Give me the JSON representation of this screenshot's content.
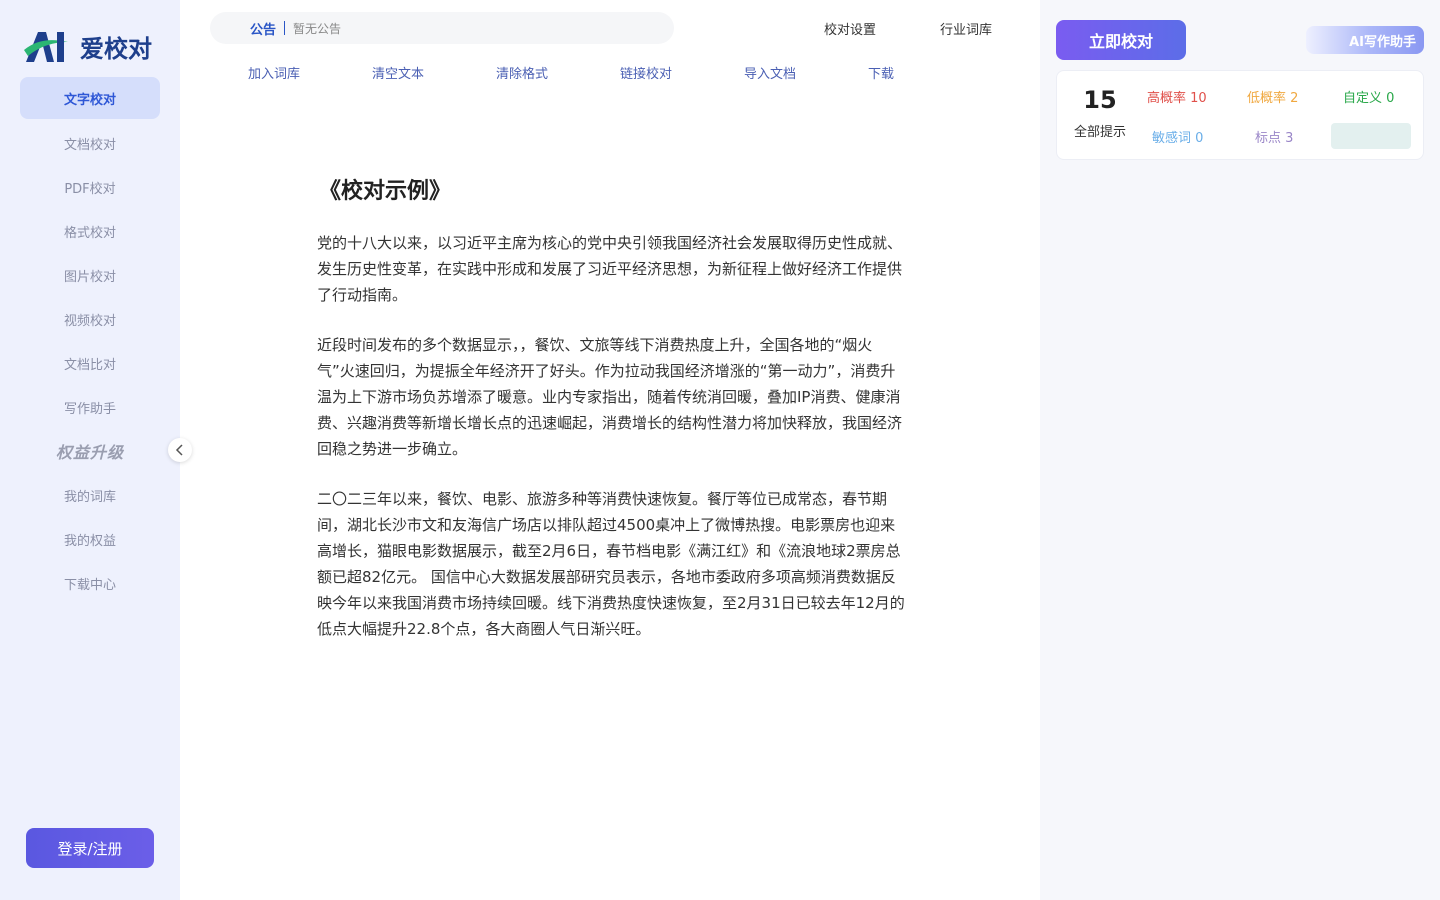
{
  "sidebar": {
    "logo_text": "爱校对",
    "items": [
      {
        "label": "文字校对"
      },
      {
        "label": "文档校对"
      },
      {
        "label": "PDF校对"
      },
      {
        "label": "格式校对"
      },
      {
        "label": "图片校对"
      },
      {
        "label": "视频校对"
      },
      {
        "label": "文档比对"
      },
      {
        "label": "写作助手"
      },
      {
        "label": "权益升级"
      },
      {
        "label": "我的词库"
      },
      {
        "label": "我的权益"
      },
      {
        "label": "下载中心"
      }
    ],
    "login_label": "登录/注册"
  },
  "notice": {
    "label": "公告",
    "text": "暂无公告"
  },
  "top_links": {
    "settings": "校对设置",
    "industry_lexicon": "行业词库"
  },
  "toolbar": {
    "add_lexicon": "加入词库",
    "clear_text": "清空文本",
    "clear_format": "清除格式",
    "link_check": "链接校对",
    "import_doc": "导入文档",
    "download": "下载"
  },
  "document": {
    "title": "《校对示例》",
    "paragraphs": [
      "党的十八大以来，以习近平主席为核心的党中央引领我国经济社会发展取得历史性成就、发生历史性变革，在实践中形成和发展了习近平经济思想，为新征程上做好经济工作提供了行动指南。",
      "近段时间发布的多个数据显示，，餐饮、文旅等线下消费热度上升，全国各地的“烟火气”火速回归，为提振全年经济开了好头。作为拉动我国经济增涨的“第一动力”，消费升温为上下游市场负苏增添了暖意。业内专家指出，随着传统消回暖，叠加IP消费、健康消费、兴趣消费等新增长增长点的迅速崛起，消费增长的结构性潜力将加快释放，我国经济回稳之势进一步确立。",
      "二〇二三年以来，餐饮、电影、旅游多种等消费快速恢复。餐厅等位已成常态，春节期间，湖北长沙市文和友海信广场店以排队超过4500桌冲上了微博热搜。电影票房也迎来高增长，猫眼电影数据展示，截至2月6日，春节档电影《满江红》和《流浪地球2票房总额已超82亿元。 国信中心大数据发展部研究员表示，各地市委政府多项高频消费数据反映今年以来我国消费市场持续回暖。线下消费热度快速恢复，至2月31日已较去年12月的低点大幅提升22.8个点，各大商圈人气日渐兴旺。"
    ]
  },
  "right_panel": {
    "check_button": "立即校对",
    "ai_button": "AI写作助手",
    "total": {
      "count": "15",
      "label": "全部提示"
    },
    "stats": {
      "high": "高概率 10",
      "low": "低概率 2",
      "custom": "自定义 0",
      "sensitive": "敏感词 0",
      "punct": "标点 3"
    }
  },
  "colors": {
    "brand": "#2e57d6",
    "high": "#e0504a",
    "low": "#f0a840",
    "custom": "#2aa84a",
    "sensitive": "#6aaee8",
    "punct": "#9a86c8"
  }
}
